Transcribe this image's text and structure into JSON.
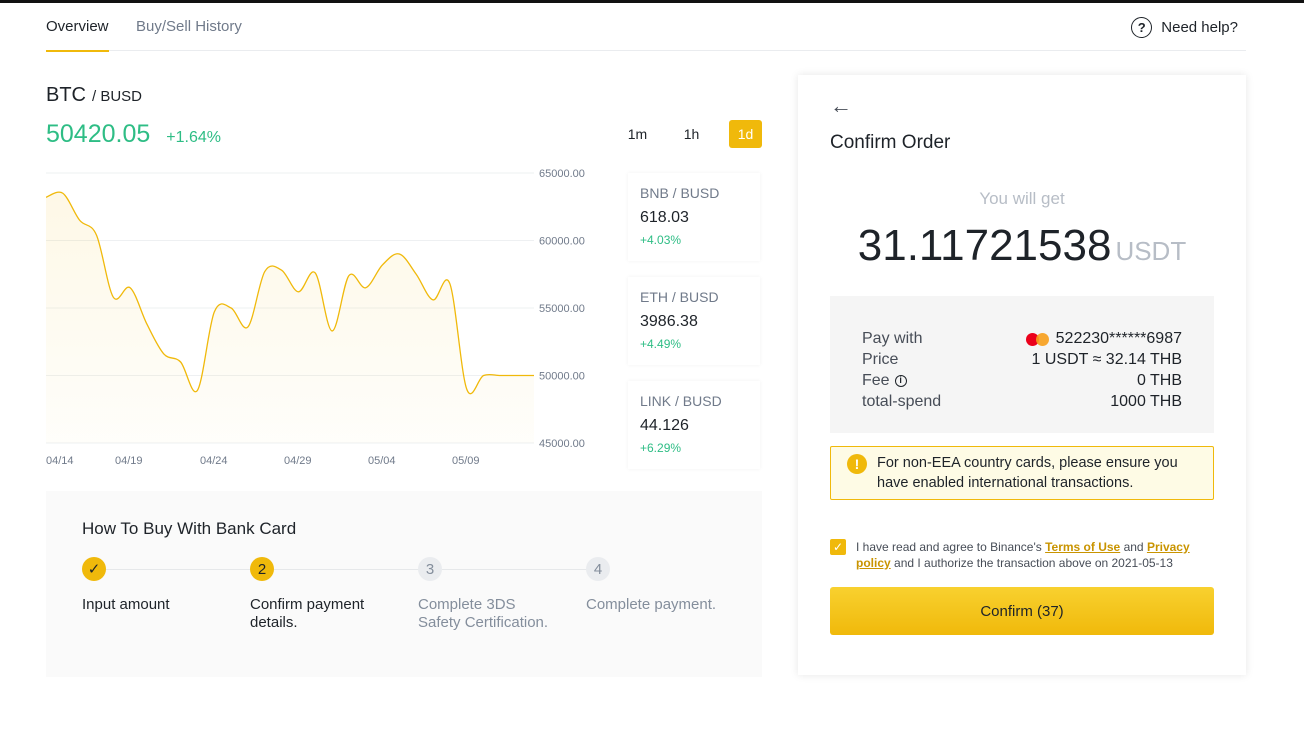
{
  "tabs": [
    {
      "label": "Overview",
      "active": true
    },
    {
      "label": "Buy/Sell History",
      "active": false
    }
  ],
  "help": {
    "label": "Need help?",
    "icon": "question-icon"
  },
  "pair": {
    "base": "BTC",
    "separator": "/",
    "quote": "BUSD",
    "price": "50420.05",
    "change": "+1.64%"
  },
  "intervals": [
    {
      "label": "1m",
      "active": false
    },
    {
      "label": "1h",
      "active": false
    },
    {
      "label": "1d",
      "active": true
    }
  ],
  "chart_data": {
    "type": "area",
    "x_ticks": [
      "04/14",
      "04/19",
      "04/24",
      "04/29",
      "05/04",
      "05/09"
    ],
    "y_ticks": [
      "65000.00",
      "60000.00",
      "55000.00",
      "50000.00",
      "45000.00"
    ],
    "ylim": [
      45000,
      65000
    ],
    "x": [
      0,
      1,
      2,
      3,
      4,
      5,
      6,
      7,
      8,
      9,
      10,
      11,
      12,
      13,
      14,
      15,
      16,
      17,
      18,
      19,
      20,
      21,
      22,
      23,
      24,
      25,
      26,
      27,
      28,
      29
    ],
    "values": [
      63200,
      63500,
      61500,
      60400,
      55800,
      56500,
      53800,
      51600,
      51000,
      48900,
      54700,
      55000,
      53600,
      57700,
      57800,
      56200,
      57600,
      53300,
      57400,
      56500,
      58200,
      59000,
      57500,
      55600,
      56800,
      49000,
      50000,
      50000,
      50000,
      50000
    ],
    "series_count": 30,
    "grid": true,
    "color": "#f0b90b"
  },
  "pair_cards": [
    {
      "pair": "BNB / BUSD",
      "price": "618.03",
      "change": "+4.03%"
    },
    {
      "pair": "ETH / BUSD",
      "price": "3986.38",
      "change": "+4.49%"
    },
    {
      "pair": "LINK / BUSD",
      "price": "44.126",
      "change": "+6.29%"
    }
  ],
  "howto": {
    "title": "How To Buy With Bank Card",
    "steps": [
      {
        "number": "✓",
        "label": "Input amount",
        "state": "done"
      },
      {
        "number": "2",
        "label": "Confirm payment details.",
        "state": "current"
      },
      {
        "number": "3",
        "label": "Complete 3DS Safety Certification.",
        "state": "todo"
      },
      {
        "number": "4",
        "label": "Complete payment.",
        "state": "todo"
      }
    ]
  },
  "confirm": {
    "title": "Confirm Order",
    "get_label": "You will get",
    "amount": "31.11721538",
    "unit": "USDT",
    "details": [
      {
        "key": "Pay with",
        "value": "522230******6987"
      },
      {
        "key": "Price",
        "value": "1 USDT ≈ 32.14 THB"
      },
      {
        "key": "Fee",
        "value": "0 THB"
      },
      {
        "key": "total-spend",
        "value": "1000 THB"
      }
    ],
    "warning": "For non-EEA country cards, please ensure you have enabled international transactions.",
    "agree_prefix": "I have read and agree to Binance's ",
    "terms": "Terms of Use",
    "and": " and ",
    "privacy": "Privacy policy",
    "agree_suffix": " and I authorize the transaction above on 2021-05-13",
    "button": "Confirm (37)"
  },
  "colors": {
    "accent": "#f0b90b",
    "up": "#2ebd85",
    "text": "#1e2329",
    "muted": "#848e9c"
  }
}
